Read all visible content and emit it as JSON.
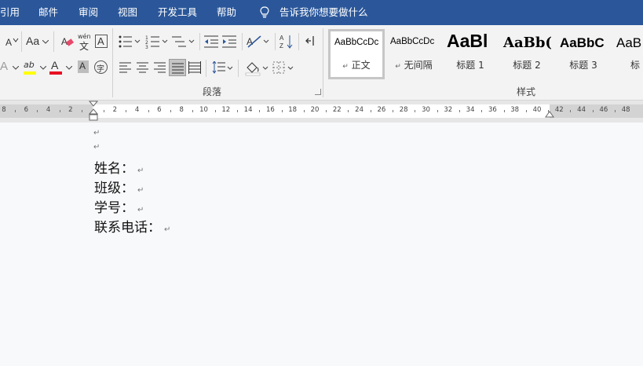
{
  "menu": {
    "tabs": [
      "引用",
      "邮件",
      "审阅",
      "视图",
      "开发工具",
      "帮助"
    ],
    "tell_me": "告诉我你想要做什么"
  },
  "ribbon": {
    "font_size_grow_label": "A",
    "change_case_label": "Aa",
    "phonetic_label": "wén",
    "phonetic_char": "文",
    "char_border_label": "A",
    "text_effect_label": "A",
    "highlight_label": "ab",
    "font_color_label": "A",
    "char_shading_label": "A",
    "enclose_char_label": "字",
    "paragraph_group_label": "段落",
    "styles_group_label": "样式",
    "highlight_color": "#ffff00",
    "font_color": "#e81123"
  },
  "styles": [
    {
      "sample": "AaBbCcDc",
      "name": "正文",
      "mark": "↵",
      "selected": true
    },
    {
      "sample": "AaBbCcDc",
      "name": "无间隔",
      "mark": "↵",
      "selected": false
    },
    {
      "sample": "AaBl",
      "name": "标题 1",
      "mark": "",
      "selected": false
    },
    {
      "sample": "AaBb(",
      "name": "标题 2",
      "mark": "",
      "selected": false
    },
    {
      "sample": "AaBbC",
      "name": "标题 3",
      "mark": "",
      "selected": false
    },
    {
      "sample": "AaB",
      "name": "标",
      "mark": "",
      "selected": false
    }
  ],
  "ruler": {
    "left_numbers": [
      "8",
      "6",
      "4",
      "2"
    ],
    "right_numbers": [
      "2",
      "4",
      "6",
      "8",
      "10",
      "12",
      "14",
      "16",
      "18",
      "20",
      "22",
      "24",
      "26",
      "28",
      "30",
      "32",
      "34",
      "36",
      "38",
      "40",
      "42",
      "44",
      "46",
      "48"
    ]
  },
  "document": {
    "empty_paragraph_mark": "↵",
    "lines": [
      {
        "text": "姓名：",
        "mark": "↵"
      },
      {
        "text": "班级：",
        "mark": "↵"
      },
      {
        "text": "学号：",
        "mark": "↵"
      },
      {
        "text": "联系电话：",
        "mark": "↵"
      }
    ]
  },
  "colors": {
    "title_bar": "#2b579a",
    "ribbon_bg": "#f3f3f3",
    "page_bg": "#f8f9fb"
  }
}
